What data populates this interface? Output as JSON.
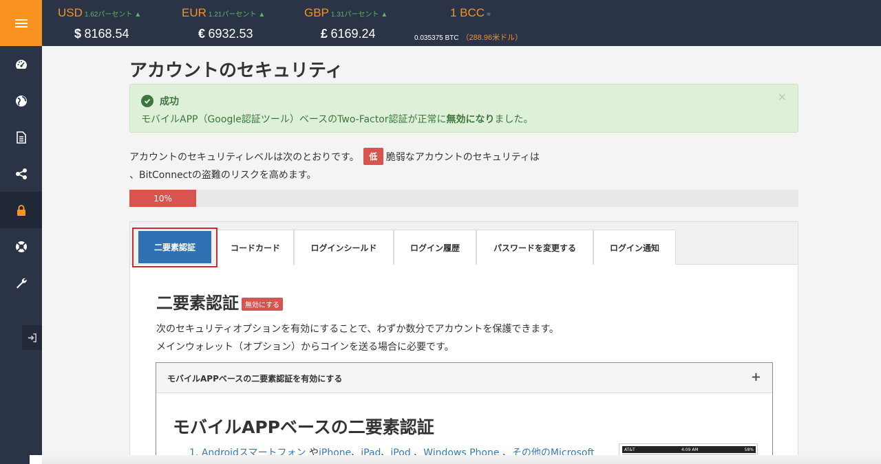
{
  "ticker": {
    "usd": {
      "code": "USD",
      "change": "1.62パーセント",
      "symbol": "$",
      "value": "8168.54"
    },
    "eur": {
      "code": "EUR",
      "change": "1.21パーセント",
      "symbol": "€",
      "value": "6932.53"
    },
    "gbp": {
      "code": "GBP",
      "change": "1.31パーセント",
      "symbol": "£",
      "value": "6169.24"
    },
    "bcc": {
      "code": "1 BCC",
      "eq": "=",
      "btc": "0.035375 BTC",
      "usd": "（288.96米ドル）"
    }
  },
  "sidebar": {
    "items": [
      {
        "name": "dashboard",
        "icon": "dashboard-icon"
      },
      {
        "name": "globe",
        "icon": "globe-icon"
      },
      {
        "name": "document",
        "icon": "document-icon"
      },
      {
        "name": "share",
        "icon": "share-icon"
      },
      {
        "name": "security",
        "icon": "lock-icon",
        "active": true
      },
      {
        "name": "support",
        "icon": "lifebuoy-icon"
      },
      {
        "name": "settings",
        "icon": "wrench-icon"
      }
    ]
  },
  "page": {
    "title": "アカウントのセキュリティ"
  },
  "alert": {
    "title": "成功",
    "message_pre": "モバイルAPP（Google認証ツール）ベースのTwo-Factor認証が正常に",
    "message_bold": "無効になり",
    "message_post": "ました。",
    "close": "×"
  },
  "security_level": {
    "text_pre": "アカウントのセキュリティレベルは次のとおりです。",
    "badge": "低",
    "text_post": "脆弱なアカウントのセキュリティは",
    "text_line2": "、BitConnectの盗難のリスクを高めます。",
    "progress_percent": 10,
    "progress_label": "10%"
  },
  "tabs": [
    {
      "label": "二要素認証",
      "active": true
    },
    {
      "label": "コードカード"
    },
    {
      "label": "ログインシールド"
    },
    {
      "label": "ログイン履歴"
    },
    {
      "label": "パスワードを変更する"
    },
    {
      "label": "ログイン通知"
    }
  ],
  "two_factor": {
    "title": "二要素認証",
    "status_badge": "無効にする",
    "desc_line1": "次のセキュリティオプションを有効にすることで、わずか数分でアカウントを保護できます。",
    "desc_line2": "メインウォレット（オプション）からコインを送る場合に必要です。",
    "accordion_header": "モバイルAPPベースの二要素認証を有効にする",
    "accordion_toggle": "+",
    "accordion_title": "モバイルAPPベースの二要素認証",
    "list_item_1": {
      "number": "1.",
      "link1": "Androidスマートフォン",
      "sep1": "や",
      "link2": "iPhone",
      "sep2": "、",
      "link3": "iPad",
      "sep3": "、",
      "link4": "iPod",
      "sep4": "、",
      "link5": "Windows Phone",
      "sep5": "、",
      "link6": "その他のMicrosoft"
    },
    "phone_status": {
      "carrier": "AT&T",
      "time": "4:09 AM",
      "battery": "58%"
    }
  },
  "colors": {
    "accent": "#f7931e",
    "sidebar": "#2b3446",
    "success_bg": "#dff0d8",
    "danger": "#d9534f",
    "tab_active": "#2e72b4"
  }
}
